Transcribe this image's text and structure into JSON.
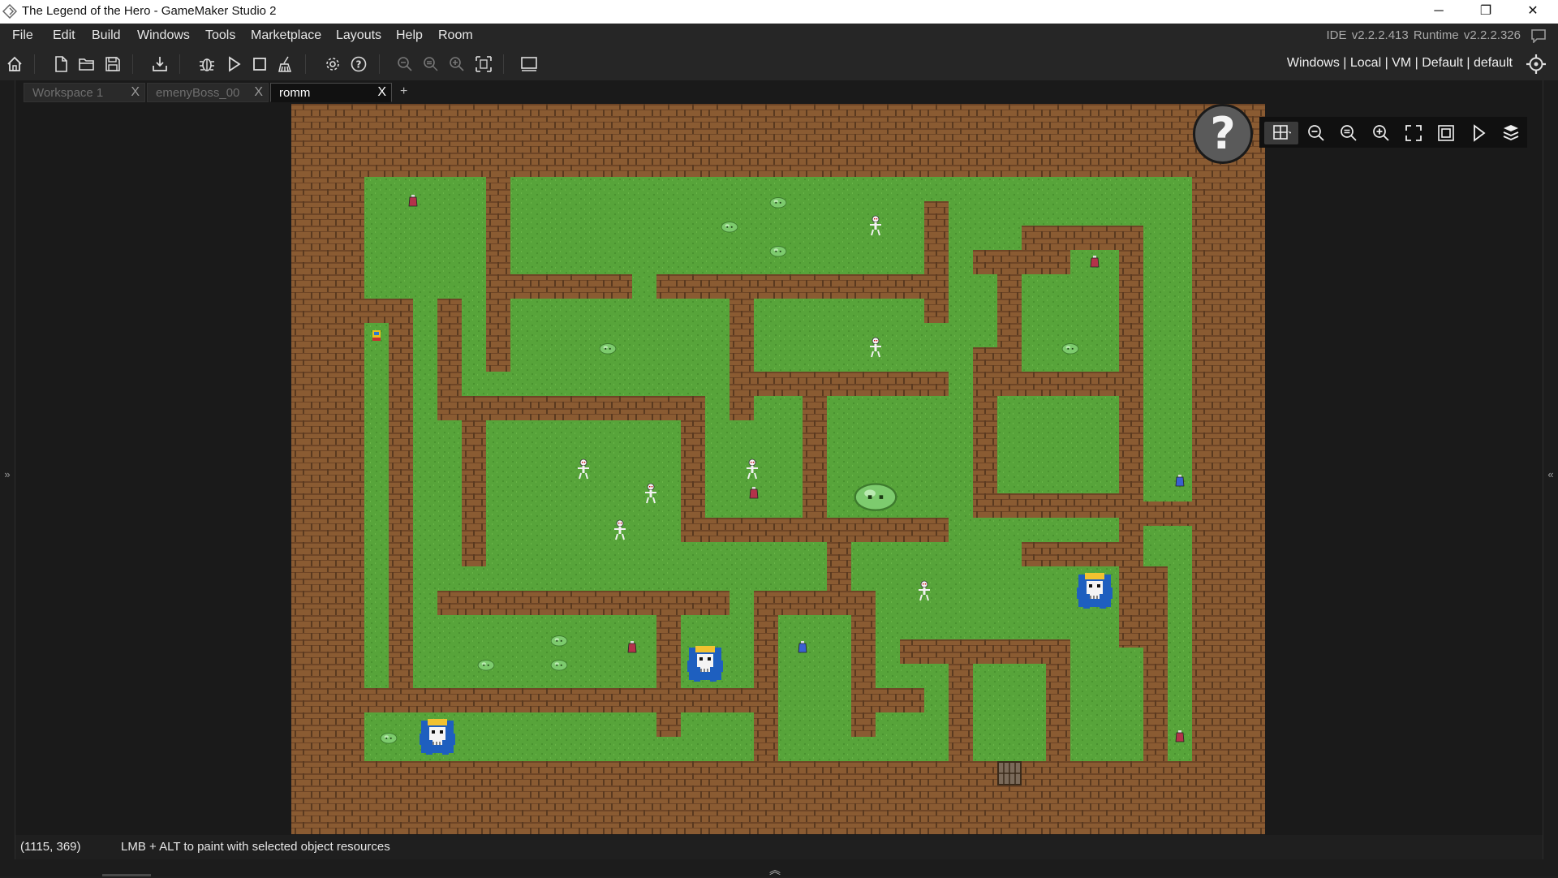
{
  "window": {
    "title": "The Legend of the Hero - GameMaker Studio 2",
    "minimize_label": "─",
    "restore_label": "❐",
    "close_label": "✕"
  },
  "menu": {
    "items": [
      "File",
      "Edit",
      "Build",
      "Windows",
      "Tools",
      "Marketplace",
      "Layouts",
      "Help",
      "Room"
    ],
    "ide_info": "IDE v2.2.2.413  Runtime v2.2.2.326"
  },
  "toolbar": {
    "buttons": [
      "home-icon",
      "new-project-icon",
      "open-project-icon",
      "save-project-icon",
      "create-executable-icon",
      "debug-icon",
      "run-icon",
      "stop-icon",
      "clean-icon",
      "game-options-icon",
      "help-icon",
      "zoom-out-icon",
      "zoom-reset-icon",
      "zoom-in-icon",
      "fit-icon",
      "output-window-icon"
    ],
    "target_info": "Windows | Local | VM | Default | default"
  },
  "tabs": {
    "items": [
      {
        "label": "Workspace 1",
        "close": "X"
      },
      {
        "label": "emenyBoss_00",
        "close": "X"
      },
      {
        "label": "romm",
        "close": "X"
      }
    ],
    "active": "romm",
    "add_label": "+"
  },
  "room_editor": {
    "help_symbol": "?",
    "tools": [
      "grid-icon",
      "zoom-out-icon",
      "zoom-reset-icon",
      "zoom-in-icon",
      "fullscreen-icon",
      "frame-icon",
      "play-icon",
      "layers-icon"
    ],
    "colors": {
      "grass": "#57a43a",
      "grass_dark": "#4a9330",
      "wall": "#8a5b32",
      "wall_dark": "#6e4526",
      "mortar": "#5a3a20"
    }
  },
  "status": {
    "coords": "(1115, 369)",
    "message": "LMB + ALT to paint with selected object resources"
  },
  "side": {
    "left_arrow": "»",
    "right_arrow": "«",
    "bottom_arrow": "︽"
  }
}
